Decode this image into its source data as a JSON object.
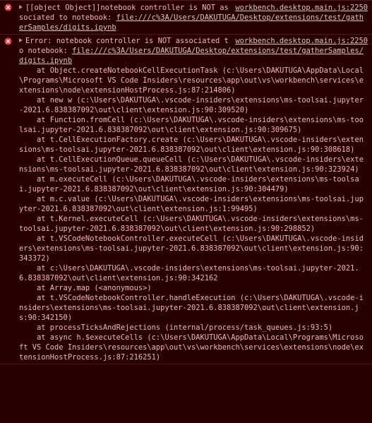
{
  "colors": {
    "background": "#290000",
    "text": "#f2b6b6",
    "link": "#d9c6c6",
    "error_icon": "#e8383d",
    "border": "#5a1414"
  },
  "messages": [
    {
      "icon": "error-circle-x-icon",
      "text": "[[object Object]]notebook controller is NOT associated to notebook: ",
      "source": "workbench.desktop.main.js:2250",
      "link": "file:///c%3A/Users/DAKUTUGA/Desktop/extensions/test/gatherSamples/digits.ipynb"
    },
    {
      "icon": "error-circle-x-icon",
      "text": "Error: notebook controller is NOT associated to notebook: ",
      "source": "workbench.desktop.main.js:2250",
      "link": "file:///c%3A/Users/DAKUTUGA/Desktop/extensions/test/gatherSamples/digits.ipynb",
      "stack": [
        "at Object.createNotebookCellExecutionTask (c:\\Users\\DAKUTUGA\\AppData\\Local\\Programs\\Microsoft VS Code Insiders\\resources\\app\\out\\vs\\workbench\\services\\extensions\\node\\extensionHostProcess.js:87:214806)",
        "at new w (c:\\Users\\DAKUTUGA\\.vscode-insiders\\extensions\\ms-toolsai.jupyter-2021.6.838387092\\out\\client\\extension.js:90:309520)",
        "at Function.fromCell (c:\\Users\\DAKUTUGA\\.vscode-insiders\\extensions\\ms-toolsai.jupyter-2021.6.838387092\\out\\client\\extension.js:90:309675)",
        "at t.CellExecutionFactory.create (c:\\Users\\DAKUTUGA\\.vscode-insiders\\extensions\\ms-toolsai.jupyter-2021.6.838387092\\out\\client\\extension.js:90:308618)",
        "at t.CellExecutionQueue.queueCell (c:\\Users\\DAKUTUGA\\.vscode-insiders\\extensions\\ms-toolsai.jupyter-2021.6.838387092\\out\\client\\extension.js:90:323924)",
        "at m.executeCell (c:\\Users\\DAKUTUGA\\.vscode-insiders\\extensions\\ms-toolsai.jupyter-2021.6.838387092\\out\\client\\extension.js:90:304479)",
        "at m.c.value (c:\\Users\\DAKUTUGA\\.vscode-insiders\\extensions\\ms-toolsai.jupyter-2021.6.838387092\\out\\client\\extension.js:1:99495)",
        "at t.Kernel.executeCell (c:\\Users\\DAKUTUGA\\.vscode-insiders\\extensions\\ms-toolsai.jupyter-2021.6.838387092\\out\\client\\extension.js:90:298852)",
        "at t.VSCodeNotebookController.executeCell (c:\\Users\\DAKUTUGA\\.vscode-insiders\\extensions\\ms-toolsai.jupyter-2021.6.838387092\\out\\client\\extension.js:90:343372)",
        "at c:\\Users\\DAKUTUGA\\.vscode-insiders\\extensions\\ms-toolsai.jupyter-2021.6.838387092\\out\\client\\extension.js:90:342162",
        "at Array.map (<anonymous>)",
        "at t.VSCodeNotebookController.handleExecution (c:\\Users\\DAKUTUGA\\.vscode-insiders\\extensions\\ms-toolsai.jupyter-2021.6.838387092\\out\\client\\extension.js:90:342150)",
        "at processTicksAndRejections (internal/process/task_queues.js:93:5)",
        "at async h.$executeCells (c:\\Users\\DAKUTUGA\\AppData\\Local\\Programs\\Microsoft VS Code Insiders\\resources\\app\\out\\vs\\workbench\\services\\extensions\\node\\extensionHostProcess.js:87:216251)"
      ]
    }
  ]
}
